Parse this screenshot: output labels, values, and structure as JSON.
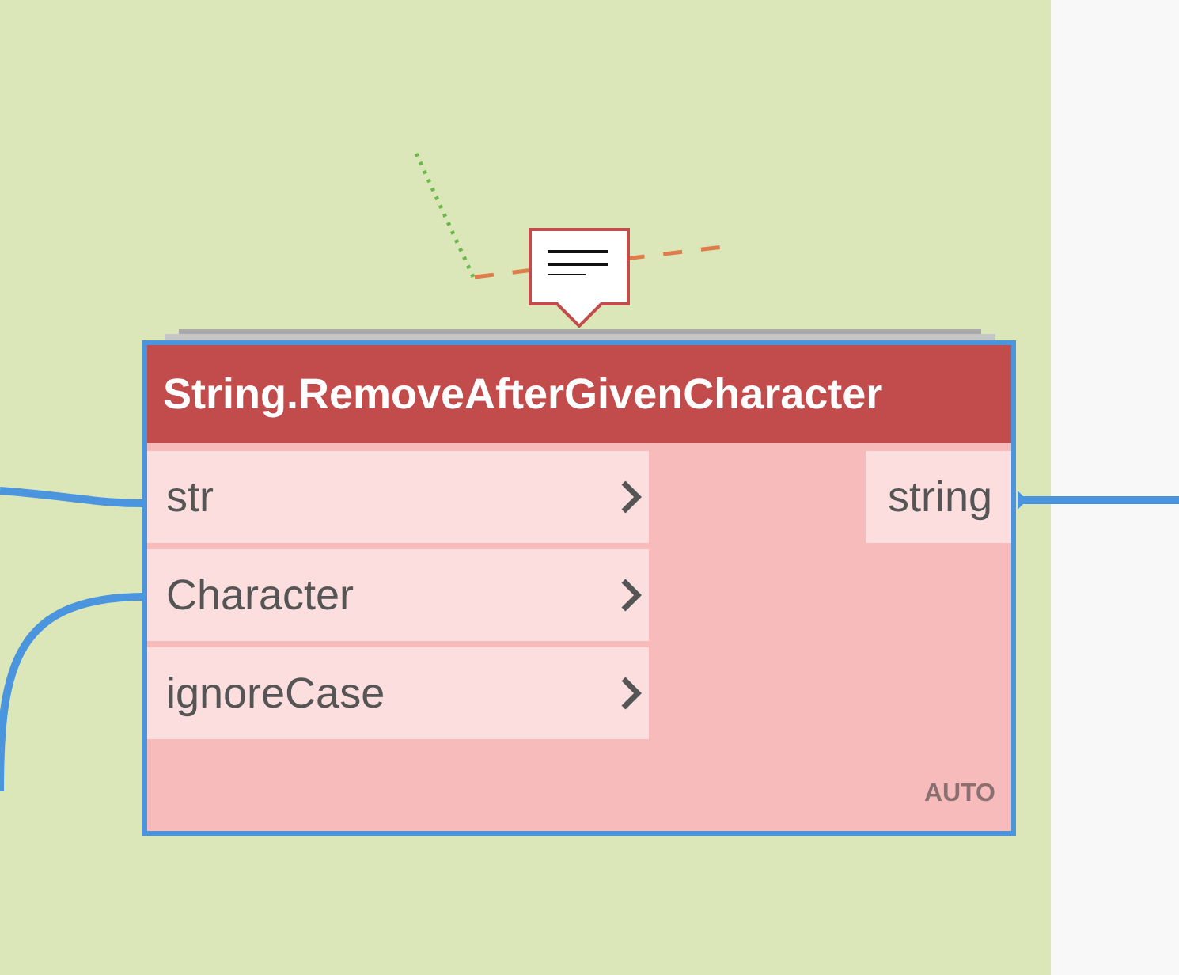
{
  "node": {
    "title": "String.RemoveAfterGivenCharacter",
    "error": true,
    "selected": true,
    "lacing": "AUTO",
    "inputs": [
      {
        "name": "str"
      },
      {
        "name": "Character"
      },
      {
        "name": "ignoreCase"
      }
    ],
    "outputs": [
      {
        "name": "string"
      }
    ]
  }
}
